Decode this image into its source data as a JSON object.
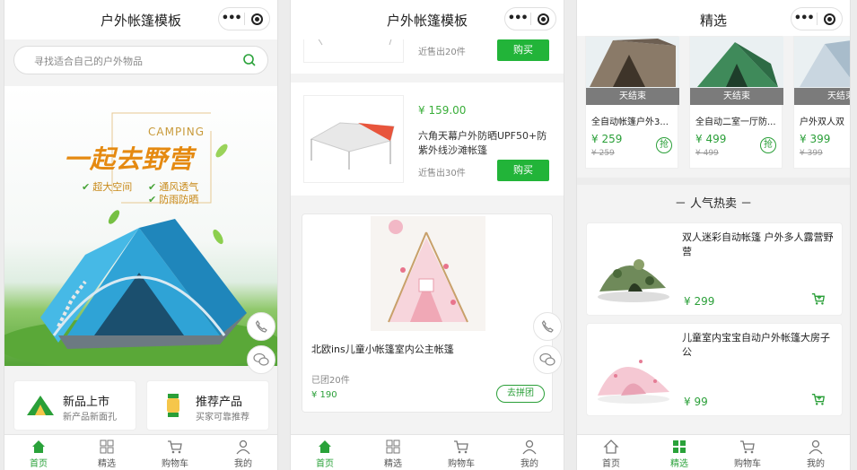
{
  "colors": {
    "brand_green": "#22b439",
    "price_green": "#2a9f38",
    "orange": "#e58a11"
  },
  "capsule": {
    "more_icon": "•••",
    "close_icon": "record-circle-icon"
  },
  "tabs": [
    {
      "label": "首页",
      "icon": "home-icon"
    },
    {
      "label": "精选",
      "icon": "grid-icon"
    },
    {
      "label": "购物车",
      "icon": "cart-icon"
    },
    {
      "label": "我的",
      "icon": "user-icon"
    }
  ],
  "screen1": {
    "title": "户外帐篷模板",
    "search_placeholder": "寻找适合自己的户外物品",
    "banner": {
      "camping": "CAMPING",
      "slogan": "一起去野营",
      "features": [
        "超大空间",
        "通风透气",
        "防雨防晒"
      ]
    },
    "quick_entries": [
      {
        "title": "新品上市",
        "subtitle": "新产品新面孔"
      },
      {
        "title": "推荐产品",
        "subtitle": "买家可靠推荐"
      }
    ]
  },
  "screen2": {
    "title": "户外帐篷模板",
    "products": [
      {
        "price": "",
        "title": "",
        "sold": "近售出20件",
        "buy": "购买"
      },
      {
        "price": "¥ 159.00",
        "title": "六角天幕户外防晒UPF50+防紫外线沙滩帐篷",
        "sold": "近售出30件",
        "buy": "购买"
      }
    ],
    "group_item": {
      "title": "北欧ins儿童小帐篷室内公主帐篷",
      "sold": "已团20件",
      "price": "¥ 190",
      "button": "去拼团"
    }
  },
  "screen3": {
    "title": "精选",
    "recommend": [
      {
        "ribbon": "天结束",
        "title": "全自动帐篷户外3...",
        "price": "¥ 259",
        "old_price": "¥ 259",
        "grab": "抢"
      },
      {
        "ribbon": "天结束",
        "title": "全自动二室一厅防...",
        "price": "¥ 499",
        "old_price": "¥ 499",
        "grab": "抢"
      },
      {
        "ribbon": "天结束",
        "title": "户外双人双",
        "price": "¥ 399",
        "old_price": "¥ 399",
        "grab": ""
      }
    ],
    "hot_title": "－ 人气热卖 －",
    "hot": [
      {
        "title": "双人迷彩自动帐篷 户外多人露营野营",
        "price": "¥ 299"
      },
      {
        "title": "儿童室内宝宝自动户外帐篷大房子公",
        "price": "¥ 99"
      }
    ]
  }
}
